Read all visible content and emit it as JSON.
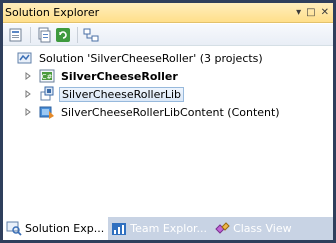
{
  "window": {
    "title": "Solution Explorer",
    "controls": {
      "dropdown": "▾",
      "pin": "□",
      "close": "✕"
    }
  },
  "toolbar": {
    "buttons": [
      "properties-icon",
      "show-all-files-icon",
      "refresh-icon",
      "view-class-diagram-icon"
    ]
  },
  "tree": {
    "nodes": [
      {
        "label": "Solution 'SilverCheeseRoller' (3 projects)",
        "icon": "solution-icon",
        "expandable": false,
        "bold": false,
        "selected": false
      },
      {
        "label": "SilverCheeseRoller",
        "icon": "csharp-project-icon",
        "expandable": true,
        "bold": true,
        "selected": false
      },
      {
        "label": "SilverCheeseRollerLib",
        "icon": "library-project-icon",
        "expandable": true,
        "bold": false,
        "selected": true
      },
      {
        "label": "SilverCheeseRollerLibContent (Content)",
        "icon": "content-project-icon",
        "expandable": true,
        "bold": false,
        "selected": false
      }
    ]
  },
  "tabs": [
    {
      "label": "Solution Exp...",
      "icon": "solution-explorer-icon",
      "active": true
    },
    {
      "label": "Team Explor...",
      "icon": "team-explorer-icon",
      "active": false
    },
    {
      "label": "Class View",
      "icon": "class-view-icon",
      "active": false
    }
  ],
  "colors": {
    "titlebar": "#ffe49a",
    "frame": "#2f3f5c",
    "tabstrip": "#c8d3e4",
    "selection_border": "#97b9dc"
  }
}
